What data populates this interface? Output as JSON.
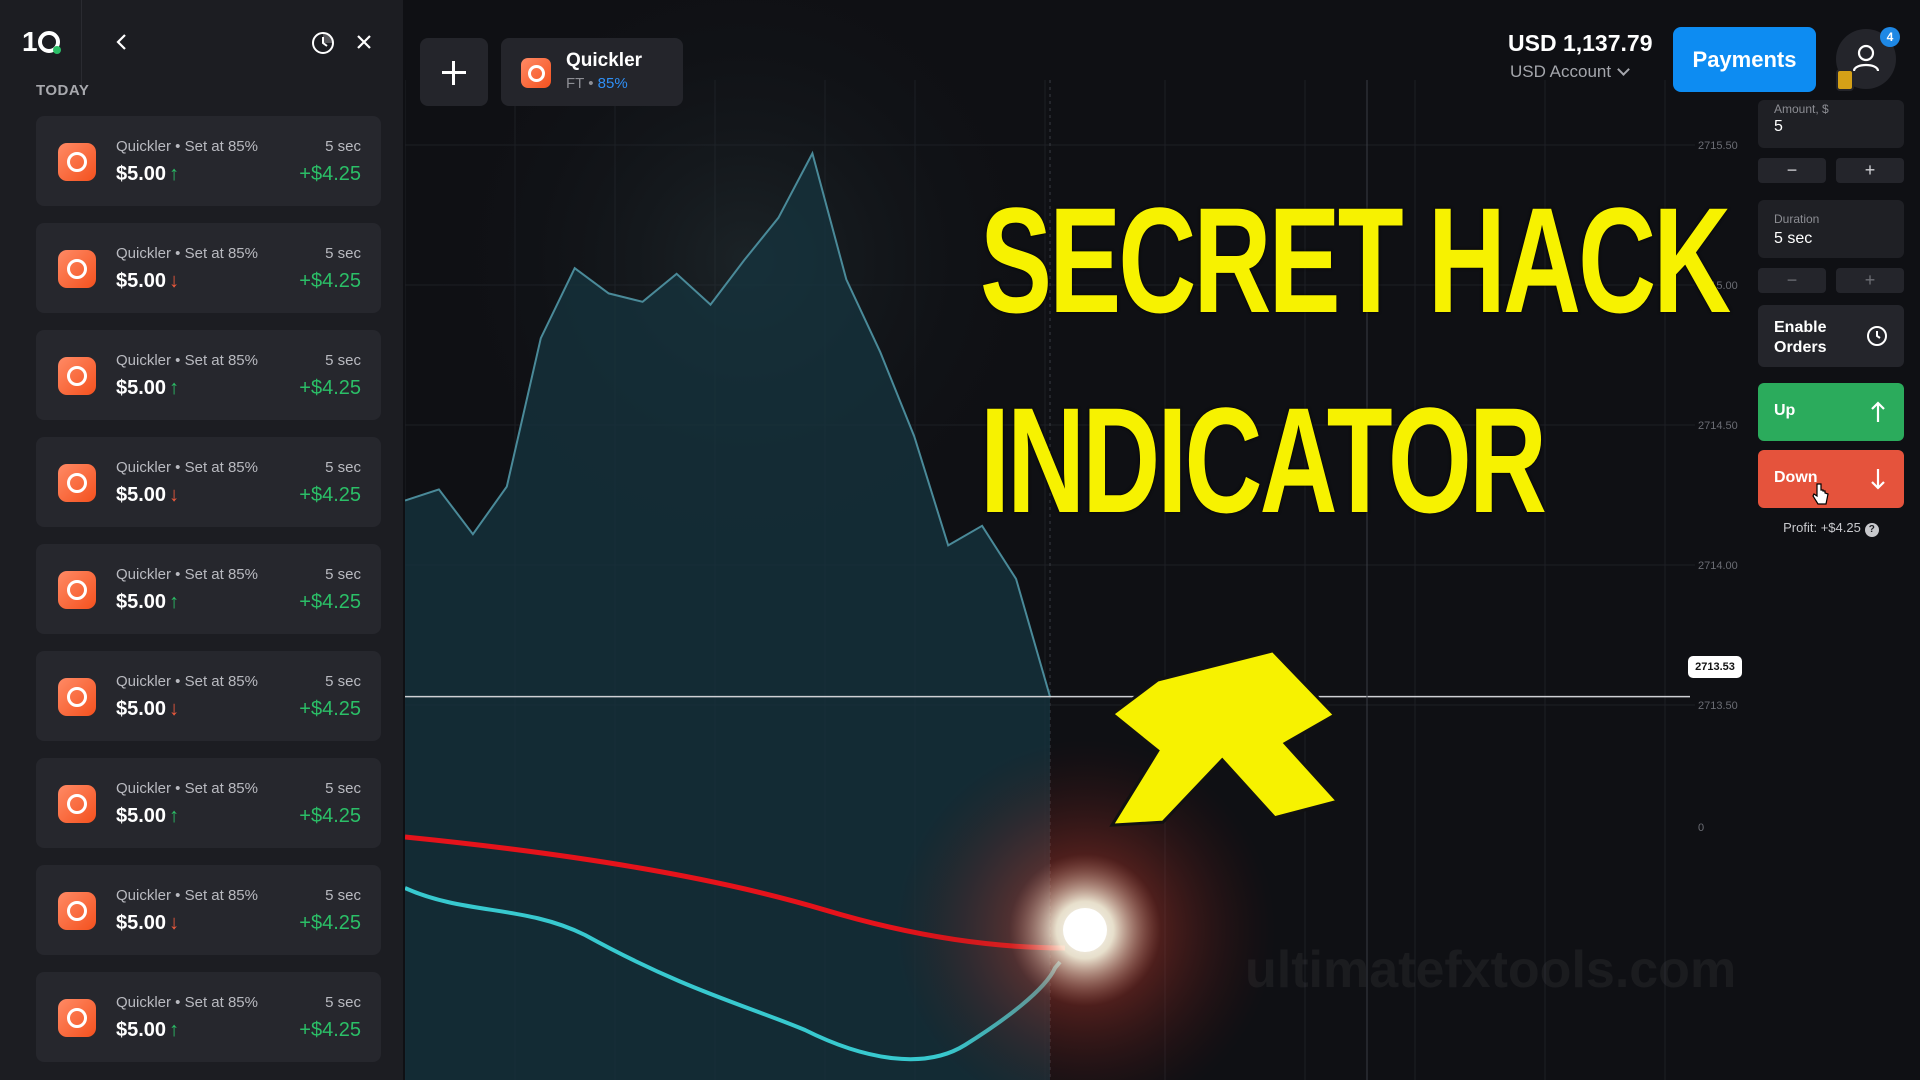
{
  "sidebar": {
    "logo": "1",
    "section_label": "TODAY",
    "trades": [
      {
        "name": "Quickler • Set at 85%",
        "amount": "$5.00",
        "direction": "up",
        "arrow": "↑",
        "duration": "5 sec",
        "profit": "+$4.25"
      },
      {
        "name": "Quickler • Set at 85%",
        "amount": "$5.00",
        "direction": "down",
        "arrow": "↓",
        "duration": "5 sec",
        "profit": "+$4.25"
      },
      {
        "name": "Quickler • Set at 85%",
        "amount": "$5.00",
        "direction": "up",
        "arrow": "↑",
        "duration": "5 sec",
        "profit": "+$4.25"
      },
      {
        "name": "Quickler • Set at 85%",
        "amount": "$5.00",
        "direction": "down",
        "arrow": "↓",
        "duration": "5 sec",
        "profit": "+$4.25"
      },
      {
        "name": "Quickler • Set at 85%",
        "amount": "$5.00",
        "direction": "up",
        "arrow": "↑",
        "duration": "5 sec",
        "profit": "+$4.25"
      },
      {
        "name": "Quickler • Set at 85%",
        "amount": "$5.00",
        "direction": "down",
        "arrow": "↓",
        "duration": "5 sec",
        "profit": "+$4.25"
      },
      {
        "name": "Quickler • Set at 85%",
        "amount": "$5.00",
        "direction": "up",
        "arrow": "↑",
        "duration": "5 sec",
        "profit": "+$4.25"
      },
      {
        "name": "Quickler • Set at 85%",
        "amount": "$5.00",
        "direction": "down",
        "arrow": "↓",
        "duration": "5 sec",
        "profit": "+$4.25"
      },
      {
        "name": "Quickler • Set at 85%",
        "amount": "$5.00",
        "direction": "up",
        "arrow": "↑",
        "duration": "5 sec",
        "profit": "+$4.25"
      }
    ]
  },
  "topbar": {
    "asset_name": "Quickler",
    "asset_type": "FT",
    "asset_separator": " • ",
    "asset_payout": "85%",
    "balance": "USD 1,137.79",
    "account": "USD Account",
    "payments_label": "Payments",
    "notification_count": "4"
  },
  "trade_panel": {
    "amount_label": "Amount, $",
    "amount_value": "5",
    "duration_label": "Duration",
    "duration_value": "5 sec",
    "minus": "−",
    "plus": "+",
    "enable_orders": "Enable\nOrders",
    "up_label": "Up",
    "down_label": "Down",
    "profit_text": "Profit: +$4.25",
    "help": "?"
  },
  "chart": {
    "current_price": "2713.53",
    "y_ticks": [
      "2715.50",
      "2715.00",
      "2714.50",
      "2714.00",
      "2713.50",
      "0"
    ],
    "price_series": [
      2714.23,
      2714.27,
      2714.11,
      2714.28,
      2714.81,
      2715.06,
      2714.97,
      2714.94,
      2715.04,
      2714.93,
      2715.09,
      2715.24,
      2715.47,
      2715.02,
      2714.76,
      2714.46,
      2714.07,
      2714.14,
      2713.95,
      2713.53
    ],
    "indicator_red": "falling line",
    "indicator_cyan": "rising line",
    "colors": {
      "area": "#15343f",
      "red_line": "#e5131b",
      "cyan_line": "#38c9cf",
      "grid": "#1d1f25"
    }
  },
  "overlay": {
    "headline": "SECRET HACK\nINDICATOR",
    "headline_color": "#f7f200",
    "watermark": "ultimatefxtools.com"
  }
}
